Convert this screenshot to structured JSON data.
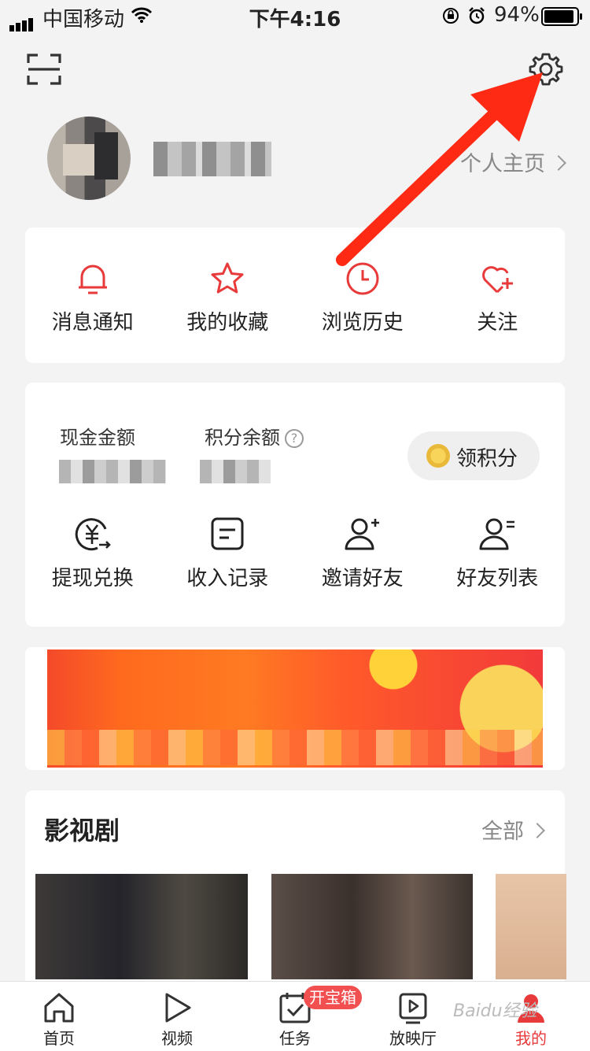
{
  "status_bar": {
    "carrier": "中国移动",
    "time": "下午4:16",
    "battery": "94%"
  },
  "profile": {
    "link_label": "个人主页"
  },
  "quick_actions": [
    {
      "label": "消息通知",
      "icon": "bell-icon"
    },
    {
      "label": "我的收藏",
      "icon": "star-icon"
    },
    {
      "label": "浏览历史",
      "icon": "clock-icon"
    },
    {
      "label": "关注",
      "icon": "heart-plus-icon"
    }
  ],
  "wallet": {
    "cash_label": "现金金额",
    "points_label": "积分余额",
    "get_points_label": "领积分",
    "coin_text": "金币",
    "actions": [
      {
        "label": "提现兑换",
        "icon": "yuan-exchange-icon"
      },
      {
        "label": "收入记录",
        "icon": "record-icon"
      },
      {
        "label": "邀请好友",
        "icon": "invite-friend-icon"
      },
      {
        "label": "好友列表",
        "icon": "friend-list-icon"
      }
    ]
  },
  "video_section": {
    "title": "影视剧",
    "all_label": "全部"
  },
  "tabbar": {
    "items": [
      {
        "label": "首页",
        "icon": "home-icon"
      },
      {
        "label": "视频",
        "icon": "play-icon"
      },
      {
        "label": "任务",
        "icon": "task-icon"
      },
      {
        "label": "放映厅",
        "icon": "theater-icon"
      },
      {
        "label": "我的",
        "icon": "profile-icon"
      }
    ],
    "task_badge": "开宝箱"
  },
  "watermark": "Baidu经验",
  "colors": {
    "accent": "#e83a3a",
    "annotation_arrow": "#ff2a14"
  }
}
